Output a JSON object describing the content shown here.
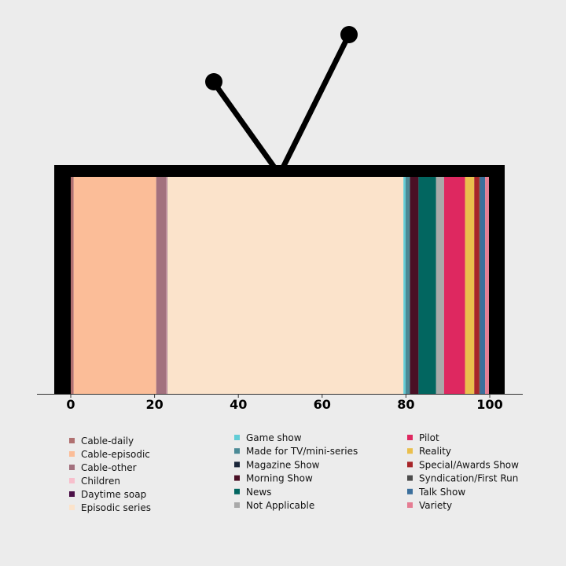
{
  "chart_data": {
    "type": "bar",
    "orientation": "horizontal-stacked",
    "x_ticks": [
      0,
      20,
      40,
      60,
      80,
      100
    ],
    "xlim": [
      -8,
      108
    ],
    "grid": false,
    "legend_position": "bottom",
    "legend_columns": 3,
    "series": [
      {
        "name": "Cable-daily",
        "value": 0.7,
        "color": "#b07070"
      },
      {
        "name": "Cable-episodic",
        "value": 19.7,
        "color": "#fbbd98"
      },
      {
        "name": "Cable-other",
        "value": 2.4,
        "color": "#a3717e"
      },
      {
        "name": "Children",
        "value": 0.1,
        "color": "#f7bfcc"
      },
      {
        "name": "Daytime soap",
        "value": 0.1,
        "color": "#4c1148"
      },
      {
        "name": "Episodic series",
        "value": 56.4,
        "color": "#fbe3cb"
      },
      {
        "name": "Game show",
        "value": 0.5,
        "color": "#62cdd6"
      },
      {
        "name": "Made for TV/mini-series",
        "value": 1.0,
        "color": "#4b8a96"
      },
      {
        "name": "Magazine Show",
        "value": 0.1,
        "color": "#1b2639"
      },
      {
        "name": "Morning Show",
        "value": 2.0,
        "color": "#4a1025"
      },
      {
        "name": "News",
        "value": 4.2,
        "color": "#026660"
      },
      {
        "name": "Not Applicable",
        "value": 1.9,
        "color": "#a9a9a9"
      },
      {
        "name": "Pilot",
        "value": 5.0,
        "color": "#de2860"
      },
      {
        "name": "Reality",
        "value": 2.2,
        "color": "#eabf4d"
      },
      {
        "name": "Special/Awards Show",
        "value": 1.2,
        "color": "#a72529"
      },
      {
        "name": "Syndication/First Run",
        "value": 0.2,
        "color": "#4d4d4d"
      },
      {
        "name": "Talk Show",
        "value": 1.2,
        "color": "#3b6f9c"
      },
      {
        "name": "Variety",
        "value": 1.1,
        "color": "#e57d93"
      }
    ]
  }
}
